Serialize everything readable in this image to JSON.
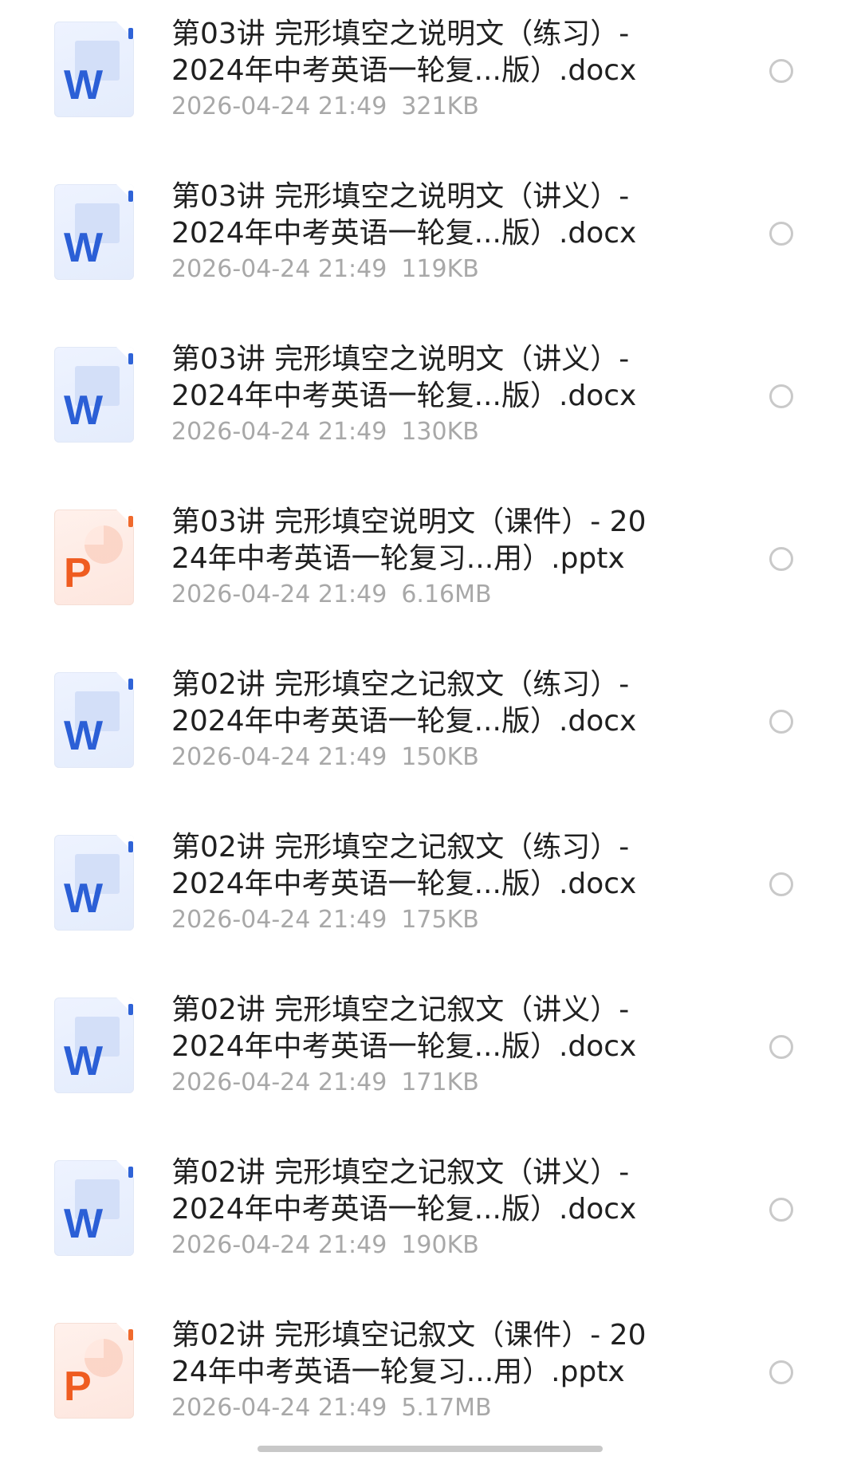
{
  "files": [
    {
      "type": "word",
      "glyph": "W",
      "icon": "word-document-icon",
      "name": "第03讲 完形填空之说明文（练习）-\n2024年中考英语一轮复...版）.docx",
      "date": "2026-04-24 21:49",
      "size": "321KB"
    },
    {
      "type": "word",
      "glyph": "W",
      "icon": "word-document-icon",
      "name": "第03讲 完形填空之说明文（讲义）-\n2024年中考英语一轮复...版）.docx",
      "date": "2026-04-24 21:49",
      "size": "119KB"
    },
    {
      "type": "word",
      "glyph": "W",
      "icon": "word-document-icon",
      "name": "第03讲 完形填空之说明文（讲义）-\n2024年中考英语一轮复...版）.docx",
      "date": "2026-04-24 21:49",
      "size": "130KB"
    },
    {
      "type": "ppt",
      "glyph": "P",
      "icon": "powerpoint-document-icon",
      "name": "第03讲 完形填空说明文（课件）- 20\n24年中考英语一轮复习...用）.pptx",
      "date": "2026-04-24 21:49",
      "size": "6.16MB"
    },
    {
      "type": "word",
      "glyph": "W",
      "icon": "word-document-icon",
      "name": "第02讲 完形填空之记叙文（练习）-\n2024年中考英语一轮复...版）.docx",
      "date": "2026-04-24 21:49",
      "size": "150KB"
    },
    {
      "type": "word",
      "glyph": "W",
      "icon": "word-document-icon",
      "name": "第02讲 完形填空之记叙文（练习）-\n2024年中考英语一轮复...版）.docx",
      "date": "2026-04-24 21:49",
      "size": "175KB"
    },
    {
      "type": "word",
      "glyph": "W",
      "icon": "word-document-icon",
      "name": "第02讲 完形填空之记叙文（讲义）-\n2024年中考英语一轮复...版）.docx",
      "date": "2026-04-24 21:49",
      "size": "171KB"
    },
    {
      "type": "word",
      "glyph": "W",
      "icon": "word-document-icon",
      "name": "第02讲 完形填空之记叙文（讲义）-\n2024年中考英语一轮复...版）.docx",
      "date": "2026-04-24 21:49",
      "size": "190KB"
    },
    {
      "type": "ppt",
      "glyph": "P",
      "icon": "powerpoint-document-icon",
      "name": "第02讲 完形填空记叙文（课件）- 20\n24年中考英语一轮复习...用）.pptx",
      "date": "2026-04-24 21:49",
      "size": "5.17MB"
    }
  ],
  "colors": {
    "word_accent": "#2b5fd6",
    "ppt_accent": "#ef5c20",
    "meta_text": "#a8a8a8",
    "radio_border": "#c9c9c9"
  }
}
